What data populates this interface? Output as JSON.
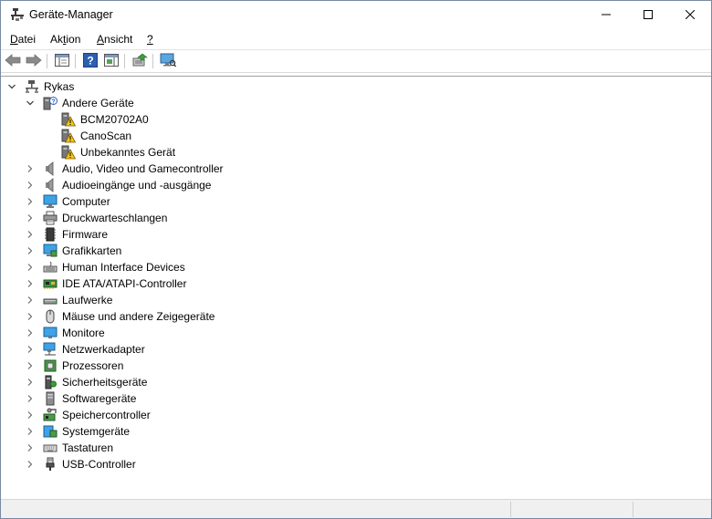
{
  "window": {
    "title": "Geräte-Manager"
  },
  "menu": [
    {
      "pre": "",
      "ul": "D",
      "post": "atei"
    },
    {
      "pre": "Ak",
      "ul": "t",
      "post": "ion"
    },
    {
      "pre": "",
      "ul": "A",
      "post": "nsicht"
    },
    {
      "pre": "",
      "ul": "?",
      "post": ""
    }
  ],
  "tree": {
    "root": {
      "label": "Rykas",
      "icon": "computer-tree-icon",
      "expanded": true
    },
    "expanded_category": {
      "label": "Andere Geräte",
      "icon": "unknown-device-icon",
      "children": [
        {
          "label": "BCM20702A0",
          "icon": "warning-device-icon"
        },
        {
          "label": "CanoScan",
          "icon": "warning-device-icon"
        },
        {
          "label": "Unbekanntes Gerät",
          "icon": "warning-device-icon"
        }
      ]
    },
    "categories": [
      {
        "label": "Audio, Video und Gamecontroller",
        "icon": "speaker-icon"
      },
      {
        "label": "Audioeingänge und -ausgänge",
        "icon": "speaker-icon"
      },
      {
        "label": "Computer",
        "icon": "monitor-icon"
      },
      {
        "label": "Druckwarteschlangen",
        "icon": "printer-icon"
      },
      {
        "label": "Firmware",
        "icon": "firmware-icon"
      },
      {
        "label": "Grafikkarten",
        "icon": "display-adapter-icon"
      },
      {
        "label": "Human Interface Devices",
        "icon": "hid-icon"
      },
      {
        "label": "IDE ATA/ATAPI-Controller",
        "icon": "ide-controller-icon"
      },
      {
        "label": "Laufwerke",
        "icon": "drive-icon"
      },
      {
        "label": "Mäuse und andere Zeigegeräte",
        "icon": "mouse-icon"
      },
      {
        "label": "Monitore",
        "icon": "monitor-icon"
      },
      {
        "label": "Netzwerkadapter",
        "icon": "network-adapter-icon"
      },
      {
        "label": "Prozessoren",
        "icon": "processor-icon"
      },
      {
        "label": "Sicherheitsgeräte",
        "icon": "security-device-icon"
      },
      {
        "label": "Softwaregeräte",
        "icon": "software-device-icon"
      },
      {
        "label": "Speichercontroller",
        "icon": "storage-controller-icon"
      },
      {
        "label": "Systemgeräte",
        "icon": "system-device-icon"
      },
      {
        "label": "Tastaturen",
        "icon": "keyboard-icon"
      },
      {
        "label": "USB-Controller",
        "icon": "usb-icon"
      }
    ]
  }
}
